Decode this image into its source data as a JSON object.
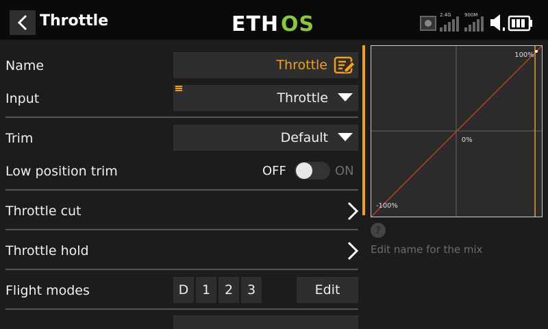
{
  "header": {
    "title": "Throttle",
    "logo_text": "ETHOS",
    "signal_2_4": "2.4G",
    "signal_900": "900M"
  },
  "form": {
    "name": {
      "label": "Name",
      "value": "Throttle"
    },
    "input": {
      "label": "Input",
      "value": "Throttle"
    },
    "trim": {
      "label": "Trim",
      "value": "Default"
    },
    "low_position_trim": {
      "label": "Low position trim",
      "off_label": "OFF",
      "on_label": "ON",
      "state": "off"
    },
    "throttle_cut": {
      "label": "Throttle cut"
    },
    "throttle_hold": {
      "label": "Throttle hold"
    },
    "flight_modes": {
      "label": "Flight modes",
      "modes": [
        "D",
        "1",
        "2",
        "3"
      ],
      "edit_label": "Edit"
    }
  },
  "graph": {
    "top_right_label": "100%",
    "center_label": "0%",
    "bottom_left_label": "-100%"
  },
  "help": {
    "icon": "?",
    "text": "Edit name for the mix"
  },
  "colors": {
    "accent_orange": "#f1a021",
    "logo_green": "#8cc63f",
    "curve_red": "#c0392b"
  }
}
